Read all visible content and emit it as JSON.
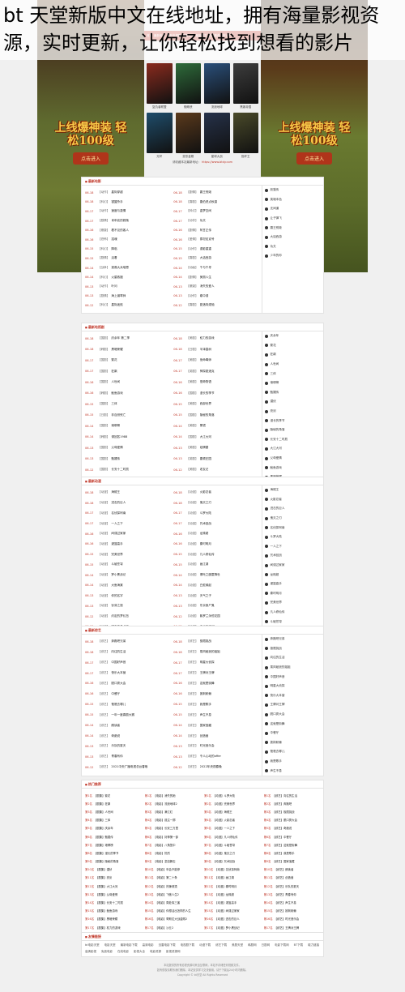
{
  "headline": "bt 天堂新版中文在线地址，拥有海量影视资源，实时更新，让你轻松找到想看的影片",
  "ads": {
    "left": {
      "big": "上线爆神装 轻松100级",
      "btn": "点击进入"
    },
    "right": {
      "big": "上线爆神装 轻松100级",
      "btn": "点击进入"
    }
  },
  "nav": [
    "首页",
    "最新电影",
    "最新电视剧",
    "最新动漫",
    "最新综艺",
    "热门推荐",
    "排行榜"
  ],
  "posters": [
    {
      "cap": "复仇者联盟",
      "color": "#8a2b1e"
    },
    {
      "cap": "蜘蛛侠",
      "color": "#2e6b3a"
    },
    {
      "cap": "流浪地球",
      "color": "#2a4f7a"
    },
    {
      "cap": "黑客帝国",
      "color": "#3d3d3d"
    },
    {
      "cap": "光环",
      "color": "#1f4d6b"
    },
    {
      "cap": "变形金刚",
      "color": "#5b3a1c"
    },
    {
      "cap": "星球大战",
      "color": "#26324a"
    },
    {
      "cap": "指环王",
      "color": "#4a4a2a"
    }
  ],
  "notice": {
    "text": "请收藏本站最新地址：",
    "url": "https://www.btdy.com"
  },
  "accent": "#c0392b",
  "sections": [
    {
      "title": "最新电影",
      "rows": [
        {
          "date": "06-18",
          "tag": "【动作】",
          "t": "星际穿越"
        },
        {
          "date": "06-18",
          "tag": "【剧情】",
          "t": "霸王别姬"
        },
        {
          "date": "06-18",
          "tag": "【科幻】",
          "t": "银翼杀手"
        },
        {
          "date": "06-18",
          "tag": "【喜剧】",
          "t": "唐伯虎点秋香"
        },
        {
          "date": "06-17",
          "tag": "【动作】",
          "t": "速度与激情"
        },
        {
          "date": "06-17",
          "tag": "【科幻】",
          "t": "盗梦空间"
        },
        {
          "date": "06-17",
          "tag": "【剧情】",
          "t": "肖申克的救赎"
        },
        {
          "date": "06-17",
          "tag": "【动作】",
          "t": "功夫"
        },
        {
          "date": "06-16",
          "tag": "【悬疑】",
          "t": "看不见的客人"
        },
        {
          "date": "06-16",
          "tag": "【剧情】",
          "t": "阿甘正传"
        },
        {
          "date": "06-16",
          "tag": "【恐怖】",
          "t": "招魂"
        },
        {
          "date": "06-16",
          "tag": "【爱情】",
          "t": "泰坦尼克号"
        },
        {
          "date": "06-15",
          "tag": "【科幻】",
          "t": "降临"
        },
        {
          "date": "06-15",
          "tag": "【动作】",
          "t": "谍影重重"
        },
        {
          "date": "06-15",
          "tag": "【剧情】",
          "t": "活着"
        },
        {
          "date": "06-15",
          "tag": "【喜剧】",
          "t": "大话西游"
        },
        {
          "date": "06-14",
          "tag": "【战争】",
          "t": "拯救大兵瑞恩"
        },
        {
          "date": "06-14",
          "tag": "【动画】",
          "t": "千与千寻"
        },
        {
          "date": "06-14",
          "tag": "【科幻】",
          "t": "火星救援"
        },
        {
          "date": "06-14",
          "tag": "【剧情】",
          "t": "美丽人生"
        },
        {
          "date": "06-13",
          "tag": "【动作】",
          "t": "叶问"
        },
        {
          "date": "06-13",
          "tag": "【悬疑】",
          "t": "消失的爱人"
        },
        {
          "date": "06-13",
          "tag": "【剧情】",
          "t": "海上钢琴师"
        },
        {
          "date": "06-13",
          "tag": "【动作】",
          "t": "碟中谍"
        },
        {
          "date": "06-12",
          "tag": "【科幻】",
          "t": "星际迷航"
        },
        {
          "date": "06-12",
          "tag": "【喜剧】",
          "t": "夏洛特烦恼"
        }
      ],
      "side": [
        "妖猫传",
        "英雄本色",
        "无间道",
        "让子弹飞",
        "霸王别姬",
        "大话西游",
        "功夫",
        "少年的你"
      ]
    },
    {
      "title": "最新电视剧",
      "rows": [
        {
          "date": "06-18",
          "tag": "【国剧】",
          "t": "庆余年 第二季"
        },
        {
          "date": "06-18",
          "tag": "【美剧】",
          "t": "权力的游戏"
        },
        {
          "date": "06-18",
          "tag": "【韩剧】",
          "t": "黑暗荣耀"
        },
        {
          "date": "06-18",
          "tag": "【日剧】",
          "t": "半泽直树"
        },
        {
          "date": "06-17",
          "tag": "【国剧】",
          "t": "繁花"
        },
        {
          "date": "06-17",
          "tag": "【美剧】",
          "t": "绝命毒师"
        },
        {
          "date": "06-17",
          "tag": "【国剧】",
          "t": "狂飙"
        },
        {
          "date": "06-17",
          "tag": "【英剧】",
          "t": "神探夏洛克"
        },
        {
          "date": "06-16",
          "tag": "【国剧】",
          "t": "人世间"
        },
        {
          "date": "06-16",
          "tag": "【美剧】",
          "t": "怪奇物语"
        },
        {
          "date": "06-16",
          "tag": "【韩剧】",
          "t": "鱿鱼游戏"
        },
        {
          "date": "06-16",
          "tag": "【国剧】",
          "t": "漫长的季节"
        },
        {
          "date": "06-15",
          "tag": "【国剧】",
          "t": "三体"
        },
        {
          "date": "06-15",
          "tag": "【美剧】",
          "t": "西部世界"
        },
        {
          "date": "06-15",
          "tag": "【日剧】",
          "t": "非自然死亡"
        },
        {
          "date": "06-15",
          "tag": "【国剧】",
          "t": "隐秘的角落"
        },
        {
          "date": "06-14",
          "tag": "【国剧】",
          "t": "琅琊榜"
        },
        {
          "date": "06-14",
          "tag": "【美剧】",
          "t": "黑镜"
        },
        {
          "date": "06-14",
          "tag": "【韩剧】",
          "t": "请回答1988"
        },
        {
          "date": "06-14",
          "tag": "【国剧】",
          "t": "大江大河"
        },
        {
          "date": "06-13",
          "tag": "【国剧】",
          "t": "父母爱情"
        },
        {
          "date": "06-13",
          "tag": "【美剧】",
          "t": "纸牌屋"
        },
        {
          "date": "06-13",
          "tag": "【国剧】",
          "t": "甄嬛传"
        },
        {
          "date": "06-13",
          "tag": "【英剧】",
          "t": "唐顿庄园"
        },
        {
          "date": "06-12",
          "tag": "【国剧】",
          "t": "长安十二时辰"
        },
        {
          "date": "06-12",
          "tag": "【美剧】",
          "t": "老友记"
        },
        {
          "date": "06-12",
          "tag": "【国剧】",
          "t": "潜伏"
        },
        {
          "date": "06-12",
          "tag": "【日剧】",
          "t": "深夜食堂"
        },
        {
          "date": "06-11",
          "tag": "【国剧】",
          "t": "亮剑"
        },
        {
          "date": "06-11",
          "tag": "【美剧】",
          "t": "越狱"
        }
      ],
      "side": [
        "庆余年",
        "繁花",
        "狂飙",
        "人世间",
        "三体",
        "琅琊榜",
        "甄嬛传",
        "潜伏",
        "亮剑",
        "漫长的季节",
        "隐秘的角落",
        "长安十二时辰",
        "大江大河",
        "父母爱情",
        "鱿鱼游戏",
        "黑暗荣耀",
        "权力的游戏",
        "绝命毒师"
      ]
    },
    {
      "title": "最新动漫",
      "rows": [
        {
          "date": "06-18",
          "tag": "【动漫】",
          "t": "海贼王"
        },
        {
          "date": "06-18",
          "tag": "【动漫】",
          "t": "火影忍者"
        },
        {
          "date": "06-18",
          "tag": "【动漫】",
          "t": "进击的巨人"
        },
        {
          "date": "06-18",
          "tag": "【动漫】",
          "t": "鬼灭之刃"
        },
        {
          "date": "06-17",
          "tag": "【动漫】",
          "t": "名侦探柯南"
        },
        {
          "date": "06-17",
          "tag": "【动漫】",
          "t": "斗罗大陆"
        },
        {
          "date": "06-17",
          "tag": "【动漫】",
          "t": "一人之下"
        },
        {
          "date": "06-17",
          "tag": "【动漫】",
          "t": "咒术回战"
        },
        {
          "date": "06-16",
          "tag": "【动漫】",
          "t": "间谍过家家"
        },
        {
          "date": "06-16",
          "tag": "【动漫】",
          "t": "龙珠超"
        },
        {
          "date": "06-16",
          "tag": "【动漫】",
          "t": "灌篮高手"
        },
        {
          "date": "06-16",
          "tag": "【动漫】",
          "t": "秦时明月"
        },
        {
          "date": "06-15",
          "tag": "【动漫】",
          "t": "完美世界"
        },
        {
          "date": "06-15",
          "tag": "【动漫】",
          "t": "凡人修仙传"
        },
        {
          "date": "06-15",
          "tag": "【动漫】",
          "t": "斗破苍穹"
        },
        {
          "date": "06-15",
          "tag": "【动漫】",
          "t": "画江湖"
        },
        {
          "date": "06-14",
          "tag": "【动漫】",
          "t": "罗小黑战记"
        },
        {
          "date": "06-14",
          "tag": "【动漫】",
          "t": "哪吒之魔童降世"
        },
        {
          "date": "06-14",
          "tag": "【动漫】",
          "t": "大鱼海棠"
        },
        {
          "date": "06-14",
          "tag": "【动漫】",
          "t": "白蛇缘起"
        },
        {
          "date": "06-13",
          "tag": "【动漫】",
          "t": "你的名字"
        },
        {
          "date": "06-13",
          "tag": "【动漫】",
          "t": "天气之子"
        },
        {
          "date": "06-13",
          "tag": "【动漫】",
          "t": "铃芽之旅"
        },
        {
          "date": "06-13",
          "tag": "【动漫】",
          "t": "东京食尸鬼"
        },
        {
          "date": "06-12",
          "tag": "【动漫】",
          "t": "约定的梦幻岛"
        },
        {
          "date": "06-12",
          "tag": "【动漫】",
          "t": "紫罗兰永恒花园"
        },
        {
          "date": "06-12",
          "tag": "【动漫】",
          "t": "钢之炼金术师"
        },
        {
          "date": "06-12",
          "tag": "【动漫】",
          "t": "命运石之门"
        },
        {
          "date": "06-11",
          "tag": "【动漫】",
          "t": "刀剑神域"
        },
        {
          "date": "06-11",
          "tag": "【动漫】",
          "t": "死亡笔记"
        }
      ],
      "side": [
        "海贼王",
        "火影忍者",
        "进击的巨人",
        "鬼灭之刃",
        "名侦探柯南",
        "斗罗大陆",
        "一人之下",
        "咒术回战",
        "间谍过家家",
        "龙珠超",
        "灌篮高手",
        "秦时明月",
        "完美世界",
        "凡人修仙传",
        "斗破苍穹",
        "画江湖",
        "罗小黑战记"
      ]
    },
    {
      "title": "最新综艺",
      "rows": [
        {
          "date": "06-18",
          "tag": "【综艺】",
          "t": "奔跑吧兄弟"
        },
        {
          "date": "06-18",
          "tag": "【综艺】",
          "t": "极限挑战"
        },
        {
          "date": "06-18",
          "tag": "【综艺】",
          "t": "向往的生活"
        },
        {
          "date": "06-18",
          "tag": "【综艺】",
          "t": "乘风破浪的姐姐"
        },
        {
          "date": "06-17",
          "tag": "【综艺】",
          "t": "中国好声音"
        },
        {
          "date": "06-17",
          "tag": "【综艺】",
          "t": "明星大侦探"
        },
        {
          "date": "06-17",
          "tag": "【综艺】",
          "t": "快乐大本营"
        },
        {
          "date": "06-17",
          "tag": "【综艺】",
          "t": "王牌对王牌"
        },
        {
          "date": "06-16",
          "tag": "【综艺】",
          "t": "脱口秀大会"
        },
        {
          "date": "06-16",
          "tag": "【综艺】",
          "t": "这就是街舞"
        },
        {
          "date": "06-16",
          "tag": "【综艺】",
          "t": "中餐厅"
        },
        {
          "date": "06-16",
          "tag": "【综艺】",
          "t": "披荆斩棘"
        },
        {
          "date": "06-15",
          "tag": "【综艺】",
          "t": "爸爸去哪儿"
        },
        {
          "date": "06-15",
          "tag": "【综艺】",
          "t": "我是歌手"
        },
        {
          "date": "06-15",
          "tag": "【综艺】",
          "t": "一年一度喜剧大赛"
        },
        {
          "date": "06-15",
          "tag": "【综艺】",
          "t": "声生不息"
        },
        {
          "date": "06-14",
          "tag": "【综艺】",
          "t": "朗读者"
        },
        {
          "date": "06-14",
          "tag": "【综艺】",
          "t": "国家宝藏"
        },
        {
          "date": "06-14",
          "tag": "【综艺】",
          "t": "奇葩说"
        },
        {
          "date": "06-14",
          "tag": "【综艺】",
          "t": "创造营"
        },
        {
          "date": "06-13",
          "tag": "【综艺】",
          "t": "乐队的夏天"
        },
        {
          "date": "06-13",
          "tag": "【综艺】",
          "t": "时光音乐会"
        },
        {
          "date": "06-13",
          "tag": "【综艺】",
          "t": "青春有你"
        },
        {
          "date": "06-13",
          "tag": "【综艺】",
          "t": "令人心动的offer"
        },
        {
          "date": "06-12",
          "tag": "【综艺】",
          "t": "2021中央广播电视总台春晚"
        },
        {
          "date": "06-12",
          "tag": "【综艺】",
          "t": "2022年央视春晚"
        }
      ],
      "side": [
        "奔跑吧兄弟",
        "极限挑战",
        "向往的生活",
        "乘风破浪的姐姐",
        "中国好声音",
        "明星大侦探",
        "快乐大本营",
        "王牌对王牌",
        "脱口秀大会",
        "这就是街舞",
        "中餐厅",
        "披荆斩棘",
        "爸爸去哪儿",
        "我是歌手",
        "声生不息"
      ]
    }
  ],
  "hot": {
    "title": "热门推荐",
    "rows": [
      {
        "rank": "第1名",
        "t": "【剧集】繁花"
      },
      {
        "rank": "第1名",
        "t": "【电影】消失的她"
      },
      {
        "rank": "第1名",
        "t": "【动漫】斗罗大陆"
      },
      {
        "rank": "第1名",
        "t": "【综艺】向往的生活"
      },
      {
        "rank": "第2名",
        "t": "【剧集】狂飙"
      },
      {
        "rank": "第2名",
        "t": "【电影】流浪地球2"
      },
      {
        "rank": "第2名",
        "t": "【动漫】完美世界"
      },
      {
        "rank": "第2名",
        "t": "【综艺】奔跑吧"
      },
      {
        "rank": "第3名",
        "t": "【剧集】人世间"
      },
      {
        "rank": "第3名",
        "t": "【电影】满江红"
      },
      {
        "rank": "第3名",
        "t": "【动漫】海贼王"
      },
      {
        "rank": "第3名",
        "t": "【综艺】极限挑战"
      },
      {
        "rank": "第4名",
        "t": "【剧集】三体"
      },
      {
        "rank": "第4名",
        "t": "【电影】孤注一掷"
      },
      {
        "rank": "第4名",
        "t": "【动漫】火影忍者"
      },
      {
        "rank": "第4名",
        "t": "【综艺】脱口秀大会"
      },
      {
        "rank": "第5名",
        "t": "【剧集】庆余年"
      },
      {
        "rank": "第5名",
        "t": "【电影】长安三万里"
      },
      {
        "rank": "第5名",
        "t": "【动漫】一人之下"
      },
      {
        "rank": "第5名",
        "t": "【综艺】奇葩说"
      },
      {
        "rank": "第6名",
        "t": "【剧集】甄嬛传"
      },
      {
        "rank": "第6名",
        "t": "【电影】封神第一部"
      },
      {
        "rank": "第6名",
        "t": "【动漫】凡人修仙传"
      },
      {
        "rank": "第6名",
        "t": "【综艺】中餐厅"
      },
      {
        "rank": "第7名",
        "t": "【剧集】琅琊榜"
      },
      {
        "rank": "第7名",
        "t": "【电影】八角笼中"
      },
      {
        "rank": "第7名",
        "t": "【动漫】斗破苍穹"
      },
      {
        "rank": "第7名",
        "t": "【综艺】这就是街舞"
      },
      {
        "rank": "第8名",
        "t": "【剧集】漫长的季节"
      },
      {
        "rank": "第8名",
        "t": "【电影】热烈"
      },
      {
        "rank": "第8名",
        "t": "【动漫】鬼灭之刃"
      },
      {
        "rank": "第8名",
        "t": "【综艺】我是歌手"
      },
      {
        "rank": "第9名",
        "t": "【剧集】隐秘的角落"
      },
      {
        "rank": "第9名",
        "t": "【电影】坚如磐石"
      },
      {
        "rank": "第9名",
        "t": "【动漫】咒术回战"
      },
      {
        "rank": "第9名",
        "t": "【综艺】国家宝藏"
      },
      {
        "rank": "第10名",
        "t": "【剧集】潜伏"
      },
      {
        "rank": "第10名",
        "t": "【电影】年会不能停"
      },
      {
        "rank": "第10名",
        "t": "【动漫】名侦探柯南"
      },
      {
        "rank": "第10名",
        "t": "【综艺】朗读者"
      },
      {
        "rank": "第11名",
        "t": "【剧集】亮剑"
      },
      {
        "rank": "第11名",
        "t": "【电影】第二十条"
      },
      {
        "rank": "第11名",
        "t": "【动漫】画江湖"
      },
      {
        "rank": "第11名",
        "t": "【综艺】创造营"
      },
      {
        "rank": "第12名",
        "t": "【剧集】大江大河"
      },
      {
        "rank": "第12名",
        "t": "【电影】热辣滚烫"
      },
      {
        "rank": "第12名",
        "t": "【动漫】秦时明月"
      },
      {
        "rank": "第12名",
        "t": "【综艺】乐队的夏天"
      },
      {
        "rank": "第13名",
        "t": "【剧集】父母爱情"
      },
      {
        "rank": "第13名",
        "t": "【电影】飞驰人生2"
      },
      {
        "rank": "第13名",
        "t": "【动漫】龙珠超"
      },
      {
        "rank": "第13名",
        "t": "【综艺】青春有你"
      },
      {
        "rank": "第14名",
        "t": "【剧集】长安十二时辰"
      },
      {
        "rank": "第14名",
        "t": "【电影】周处除三害"
      },
      {
        "rank": "第14名",
        "t": "【动漫】灌篮高手"
      },
      {
        "rank": "第14名",
        "t": "【综艺】声生不息"
      },
      {
        "rank": "第15名",
        "t": "【剧集】鱿鱼游戏"
      },
      {
        "rank": "第15名",
        "t": "【电影】你想活出怎样的人生"
      },
      {
        "rank": "第15名",
        "t": "【动漫】间谍过家家"
      },
      {
        "rank": "第15名",
        "t": "【综艺】披荆斩棘"
      },
      {
        "rank": "第16名",
        "t": "【剧集】黑暗荣耀"
      },
      {
        "rank": "第16名",
        "t": "【电影】哥斯拉大战金刚2"
      },
      {
        "rank": "第16名",
        "t": "【动漫】进击的巨人"
      },
      {
        "rank": "第16名",
        "t": "【综艺】时光音乐会"
      },
      {
        "rank": "第17名",
        "t": "【剧集】权力的游戏"
      },
      {
        "rank": "第17名",
        "t": "【电影】沙丘2"
      },
      {
        "rank": "第17名",
        "t": "【动漫】罗小黑战记"
      },
      {
        "rank": "第17名",
        "t": "【综艺】王牌对王牌"
      }
    ]
  },
  "links": {
    "title": "友情链接",
    "items": [
      "bt电影天堂",
      "电影天堂",
      "最新电影下载",
      "高清电影",
      "迅雷电影下载",
      "电视剧下载",
      "动漫下载",
      "综艺下载",
      "美剧天堂",
      "韩剧网",
      "日剧网",
      "电影下载网",
      "BT下载",
      "磁力链接",
      "高清影视",
      "免费电影",
      "在线电影",
      "影视大全",
      "电影资源",
      "影视资源网"
    ]
  },
  "footer": [
    "本站提供的所有影视资源均来自互联网，本站不存储任何视频文件。",
    "如有侵权请联系我们删除，本站仅供学习交流使用，请于下载后24小时内删除。",
    "Copyright © bt天堂 All Rights Reserved"
  ]
}
